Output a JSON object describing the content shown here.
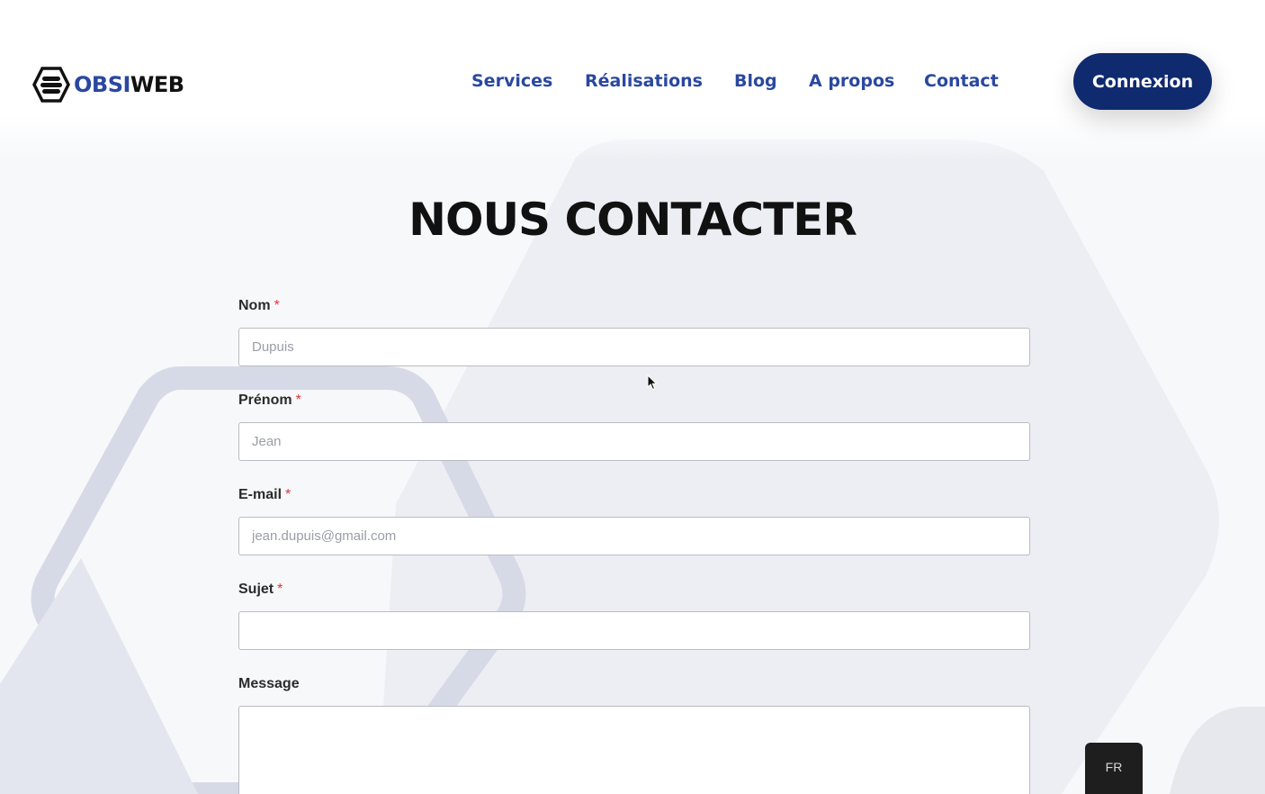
{
  "header": {
    "logo": {
      "part1": "OBSI",
      "part2": "WEB"
    },
    "nav": [
      {
        "label": "Services"
      },
      {
        "label": "Réalisations"
      },
      {
        "label": "Blog"
      },
      {
        "label": "A propos"
      },
      {
        "label": "Contact"
      }
    ],
    "login_label": "Connexion"
  },
  "main": {
    "title": "NOUS CONTACTER",
    "form": {
      "nom": {
        "label": "Nom",
        "required_mark": "*",
        "placeholder": "Dupuis",
        "value": ""
      },
      "prenom": {
        "label": "Prénom",
        "required_mark": "*",
        "placeholder": "Jean",
        "value": ""
      },
      "email": {
        "label": "E-mail",
        "required_mark": "*",
        "placeholder": "jean.dupuis@gmail.com",
        "value": ""
      },
      "sujet": {
        "label": "Sujet",
        "required_mark": "*",
        "placeholder": "",
        "value": ""
      },
      "message": {
        "label": "Message",
        "placeholder": "",
        "value": ""
      }
    }
  },
  "language_switcher": {
    "label": "FR"
  },
  "colors": {
    "brand_blue": "#2a48a0",
    "button_navy": "#0f2a6e",
    "required_red": "#d9363e",
    "background": "#f7f8fa"
  }
}
